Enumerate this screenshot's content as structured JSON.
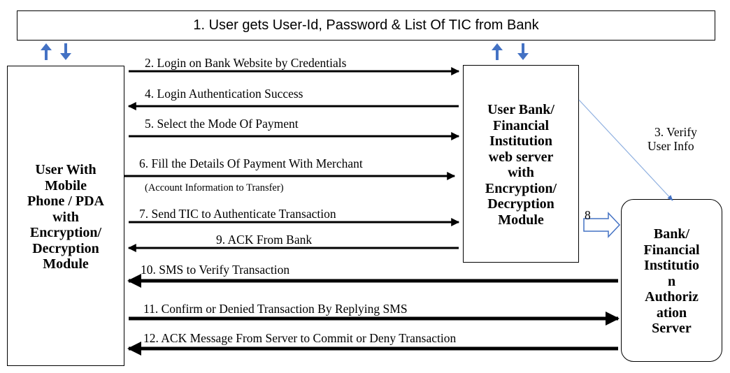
{
  "top_bar": {
    "text": "1. User gets User-Id, Password & List Of TIC from Bank"
  },
  "user_box": {
    "lines": [
      "User With",
      "Mobile",
      "Phone / PDA",
      "with",
      "Encryption/",
      "Decryption",
      "Module"
    ]
  },
  "bank_box": {
    "lines": [
      "User Bank/",
      "Financial",
      "Institution",
      "web server",
      "with",
      "Encryption/",
      "Decryption",
      "Module"
    ]
  },
  "auth_box": {
    "lines": [
      "Bank/",
      "Financial",
      "Institutio",
      "n",
      "Authoriz",
      "ation",
      "Server"
    ]
  },
  "messages": {
    "m2": "2. Login on Bank Website by Credentials",
    "m4": "4. Login Authentication Success",
    "m5": "5. Select the Mode Of Payment",
    "m6": "6. Fill the Details Of Payment With Merchant",
    "m6_note": "(Account Information to Transfer)",
    "m7": "7. Send TIC to Authenticate Transaction",
    "m8": "8",
    "m9": "9. ACK From Bank",
    "m10": "10. SMS to Verify Transaction",
    "m11": "11. Confirm or Denied Transaction By Replying SMS",
    "m12": "12. ACK Message From Server to Commit or Deny Transaction"
  },
  "verify": {
    "line1": "3. Verify",
    "line2": "User Info"
  },
  "colors": {
    "updown_arrow": "#4472c4",
    "verify_line": "#8fb0e0",
    "hollow_arrow": "#4472c4",
    "stroke": "#000000"
  }
}
